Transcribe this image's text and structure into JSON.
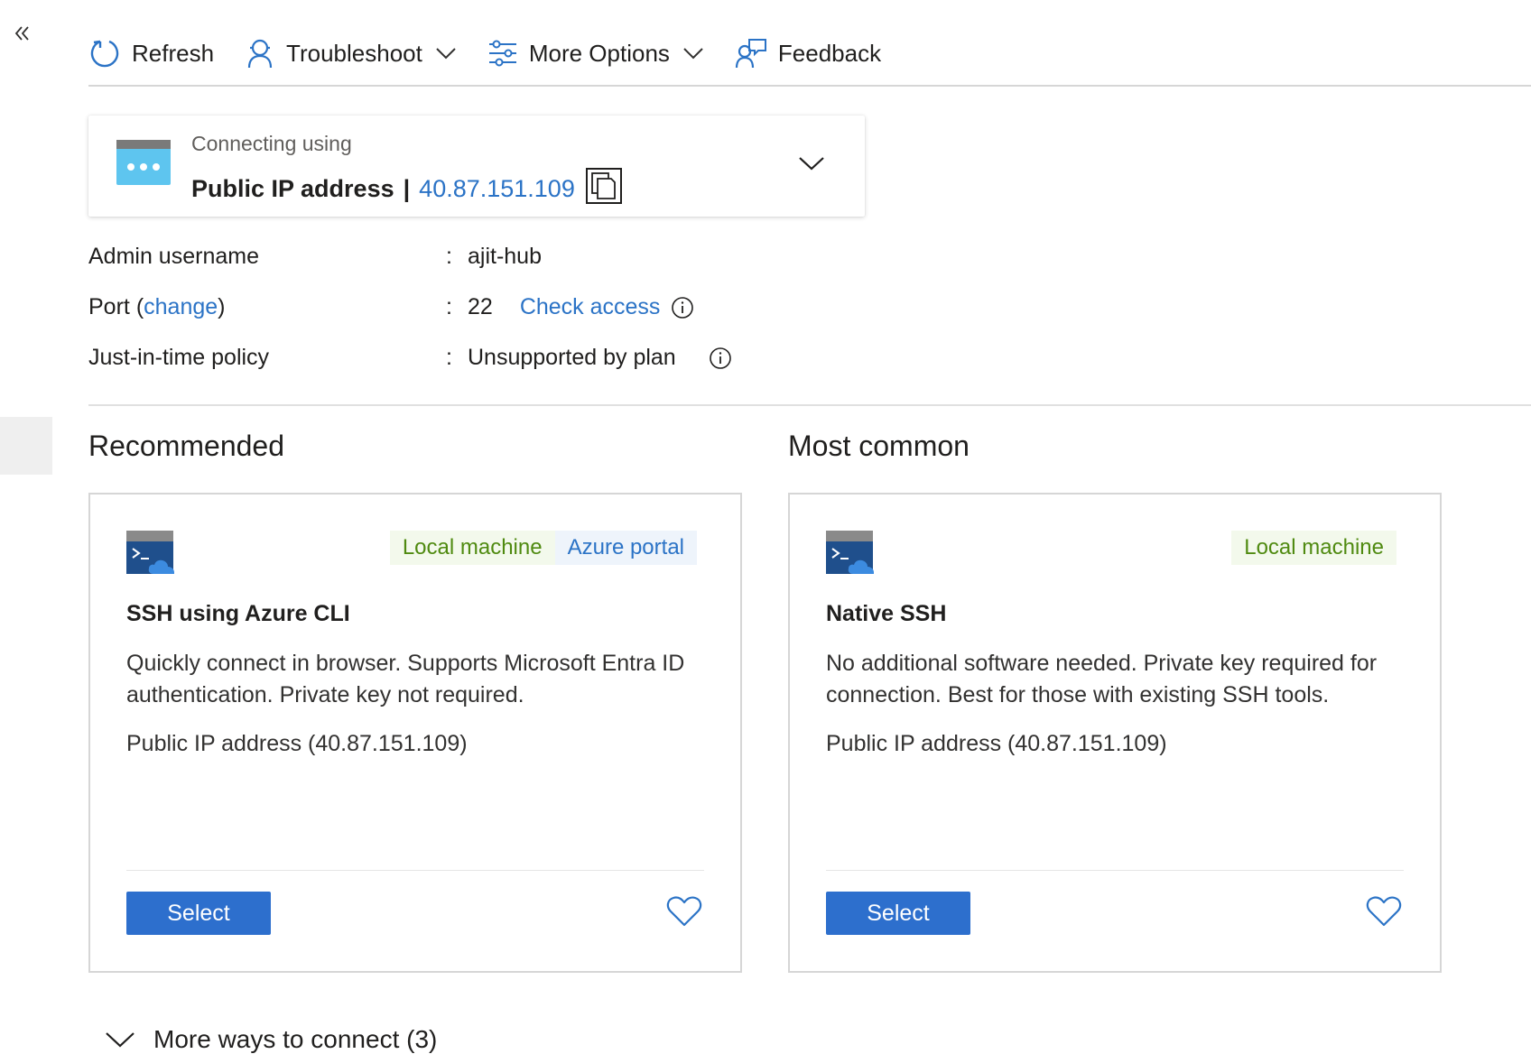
{
  "toolbar": {
    "refresh_label": "Refresh",
    "troubleshoot_label": "Troubleshoot",
    "more_options_label": "More Options",
    "feedback_label": "Feedback"
  },
  "connection": {
    "subtitle": "Connecting using",
    "method": "Public IP address",
    "separator": "|",
    "ip": "40.87.151.109"
  },
  "properties": {
    "admin_label": "Admin username",
    "admin_value": "ajit-hub",
    "port_label": "Port",
    "port_open": "(",
    "port_change_link": "change",
    "port_close": ")",
    "port_value": "22",
    "check_access_link": "Check access",
    "jit_label": "Just-in-time policy",
    "jit_value": "Unsupported by plan",
    "colon": ":"
  },
  "sections": {
    "recommended": "Recommended",
    "most_common": "Most common"
  },
  "cards": [
    {
      "tags": [
        "Local machine",
        "Azure portal"
      ],
      "title": "SSH using Azure CLI",
      "description": "Quickly connect in browser. Supports Microsoft Entra ID authentication. Private key not required.",
      "address": "Public IP address (40.87.151.109)",
      "button": "Select"
    },
    {
      "tags": [
        "Local machine"
      ],
      "title": "Native SSH",
      "description": "No additional software needed. Private key required for connection. Best for those with existing SSH tools.",
      "address": "Public IP address (40.87.151.109)",
      "button": "Select"
    }
  ],
  "more_ways_label": "More ways to connect (3)",
  "colors": {
    "accent": "#2b73c6",
    "button": "#2d6fcd",
    "tag_green_text": "#4f8a10",
    "tag_green_bg": "#f3f9ec",
    "tag_blue_bg": "#eef4fb"
  }
}
